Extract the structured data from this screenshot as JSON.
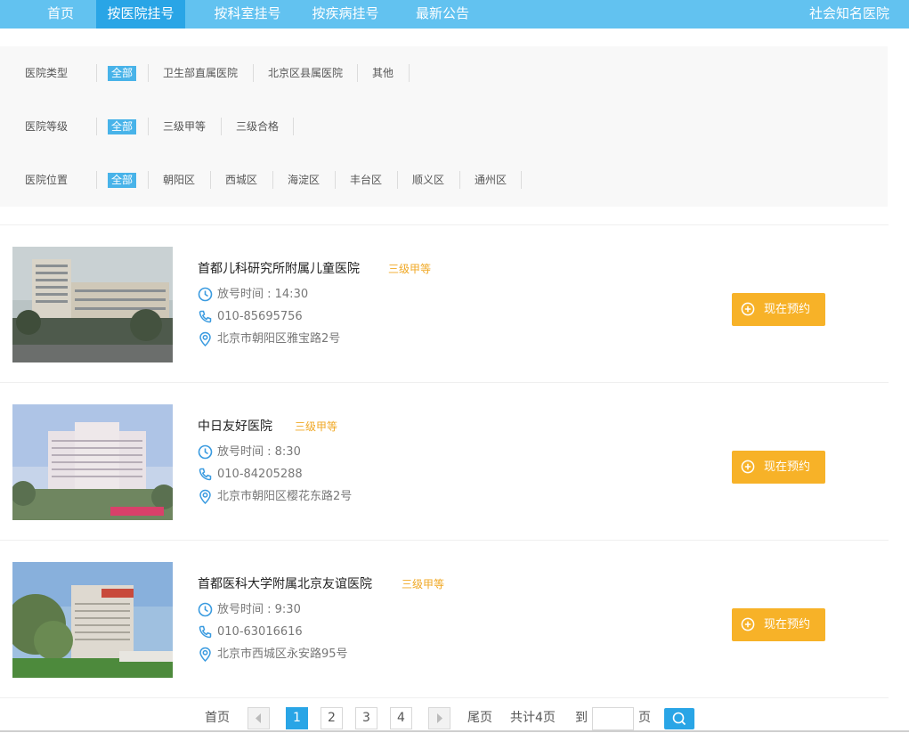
{
  "nav": {
    "items": [
      {
        "label": "首页"
      },
      {
        "label": "按医院挂号"
      },
      {
        "label": "按科室挂号"
      },
      {
        "label": "按疾病挂号"
      },
      {
        "label": "最新公告"
      }
    ],
    "active_index": 1,
    "right_label": "社会知名医院"
  },
  "filters": [
    {
      "label": "医院类型",
      "options": [
        "全部",
        "卫生部直属医院",
        "北京区县属医院",
        "其他"
      ],
      "selected": "全部"
    },
    {
      "label": "医院等级",
      "options": [
        "全部",
        "三级甲等",
        "三级合格"
      ],
      "selected": "全部"
    },
    {
      "label": "医院位置",
      "options": [
        "全部",
        "朝阳区",
        "西城区",
        "海淀区",
        "丰台区",
        "顺义区",
        "通州区"
      ],
      "selected": "全部"
    }
  ],
  "hospitals": [
    {
      "name": "首都儿科研究所附属儿童医院",
      "level": "三级甲等",
      "time": "放号时间 : 14:30",
      "phone": "010-85695756",
      "address": "北京市朝阳区雅宝路2号",
      "book_label": "现在预约"
    },
    {
      "name": "中日友好医院",
      "level": "三级甲等",
      "time": "放号时间 : 8:30",
      "phone": "010-84205288",
      "address": "北京市朝阳区樱花东路2号",
      "book_label": "现在预约"
    },
    {
      "name": "首都医科大学附属北京友谊医院",
      "level": "三级甲等",
      "time": "放号时间 : 9:30",
      "phone": "010-63016616",
      "address": "北京市西城区永安路95号",
      "book_label": "现在预约"
    }
  ],
  "pagination": {
    "first_label": "首页",
    "pages": [
      "1",
      "2",
      "3",
      "4"
    ],
    "current": "1",
    "last_label": "尾页",
    "total_label": "共计4页",
    "goto_label": "到",
    "page_suffix": "页",
    "goto_value": ""
  },
  "colors": {
    "nav": "#62c2f0",
    "nav_active": "#29a5e6",
    "accent": "#f7b228",
    "level": "#f0a824"
  }
}
